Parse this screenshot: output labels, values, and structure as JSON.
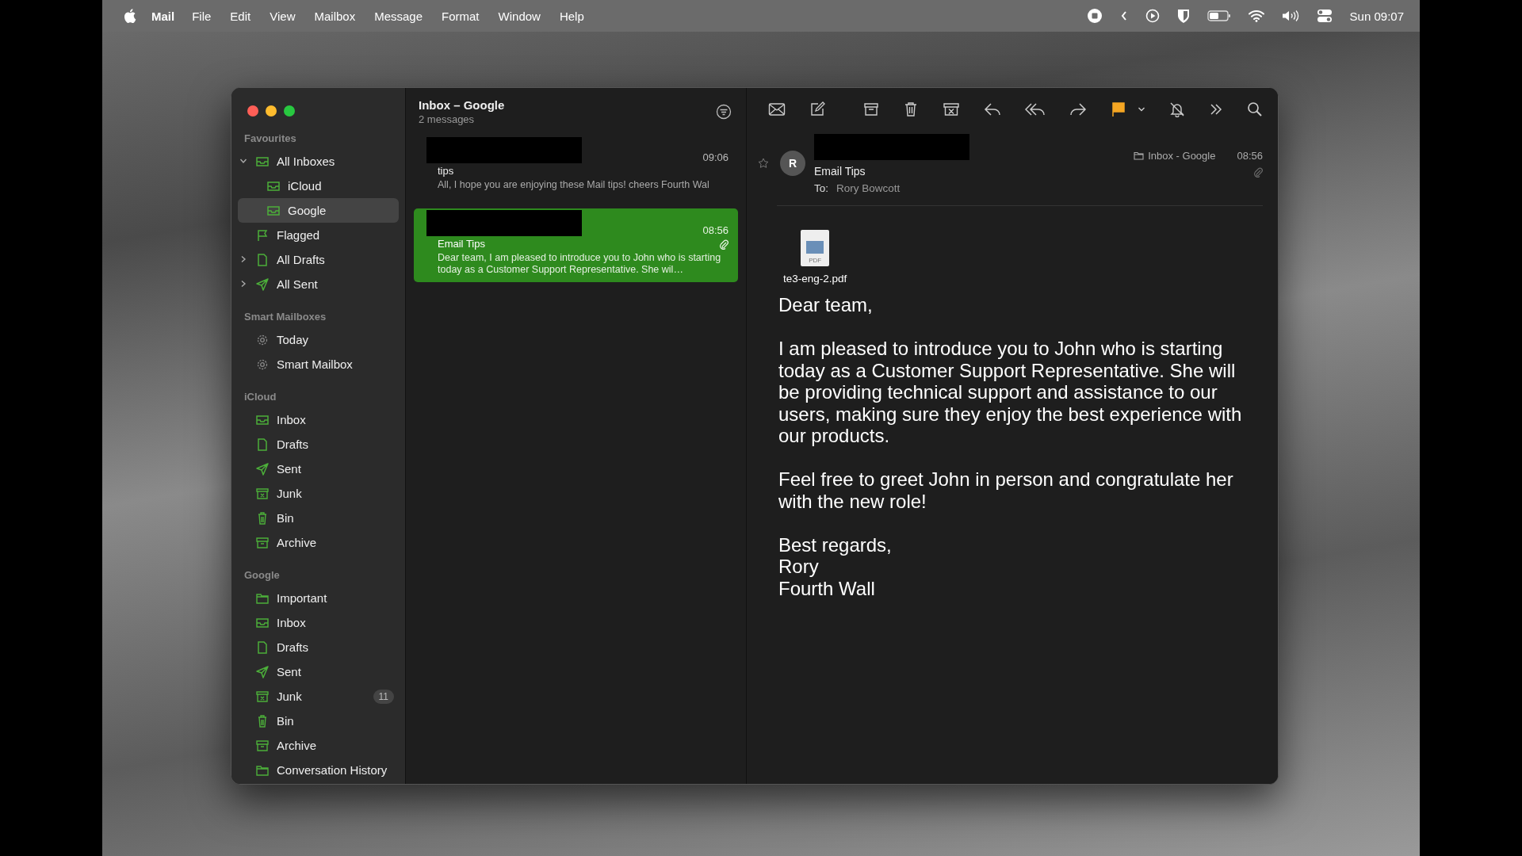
{
  "menu_bar": {
    "app_name": "Mail",
    "menus": [
      "File",
      "Edit",
      "View",
      "Mailbox",
      "Message",
      "Format",
      "Window",
      "Help"
    ],
    "clock": "Sun 09:07"
  },
  "sidebar": {
    "sections": [
      {
        "title": "Favourites",
        "items": [
          {
            "label": "All Inboxes",
            "kind": "inbox",
            "selected": false,
            "expanded": true,
            "children": [
              {
                "label": "iCloud",
                "kind": "inbox",
                "selected": false
              },
              {
                "label": "Google",
                "kind": "inbox",
                "selected": true
              }
            ]
          },
          {
            "label": "Flagged",
            "kind": "flag",
            "selected": false
          },
          {
            "label": "All Drafts",
            "kind": "drafts",
            "selected": false,
            "expanded": false
          },
          {
            "label": "All Sent",
            "kind": "sent",
            "selected": false,
            "expanded": false
          }
        ]
      },
      {
        "title": "Smart Mailboxes",
        "items": [
          {
            "label": "Today",
            "kind": "smart",
            "selected": false
          },
          {
            "label": "Smart Mailbox",
            "kind": "smart",
            "selected": false
          }
        ]
      },
      {
        "title": "iCloud",
        "items": [
          {
            "label": "Inbox",
            "kind": "inbox",
            "selected": false
          },
          {
            "label": "Drafts",
            "kind": "drafts",
            "selected": false
          },
          {
            "label": "Sent",
            "kind": "sent",
            "selected": false
          },
          {
            "label": "Junk",
            "kind": "junk",
            "selected": false
          },
          {
            "label": "Bin",
            "kind": "bin",
            "selected": false
          },
          {
            "label": "Archive",
            "kind": "archive",
            "selected": false
          }
        ]
      },
      {
        "title": "Google",
        "items": [
          {
            "label": "Important",
            "kind": "folder",
            "selected": false
          },
          {
            "label": "Inbox",
            "kind": "inbox",
            "selected": false
          },
          {
            "label": "Drafts",
            "kind": "drafts",
            "selected": false
          },
          {
            "label": "Sent",
            "kind": "sent",
            "selected": false
          },
          {
            "label": "Junk",
            "kind": "junk",
            "selected": false,
            "badge": "11"
          },
          {
            "label": "Bin",
            "kind": "bin",
            "selected": false
          },
          {
            "label": "Archive",
            "kind": "archive",
            "selected": false
          },
          {
            "label": "Conversation History",
            "kind": "folder",
            "selected": false
          }
        ]
      }
    ]
  },
  "message_list": {
    "title": "Inbox – Google",
    "count": "2 messages",
    "messages": [
      {
        "time": "09:06",
        "subject": "tips",
        "preview": "All, I hope you are enjoying these Mail tips! cheers Fourth Wal",
        "selected": false,
        "attachment": false
      },
      {
        "time": "08:56",
        "subject": "Email Tips",
        "preview": "Dear team, I am pleased to introduce you to John who is starting today as a Customer Support Representative. She wil…",
        "selected": true,
        "attachment": true
      }
    ]
  },
  "reader": {
    "avatar": "R",
    "subject": "Email Tips",
    "to_label": "To:",
    "to": "Rory Bowcott",
    "mailbox": "Inbox - Google",
    "time": "08:56",
    "attachment": {
      "file_type": "PDF",
      "name": "te3-eng-2.pdf"
    },
    "body": [
      {
        "lines": [
          "Dear team,"
        ]
      },
      {
        "lines": [
          "I am pleased to introduce you to John who is starting today as a Customer Support Representative. She will be providing technical support and assistance to our users, making sure they enjoy the best experience with our products."
        ]
      },
      {
        "lines": [
          "Feel free to greet John in person and congratulate her with the new role!"
        ]
      },
      {
        "lines": [
          "Best regards,",
          "Rory",
          "Fourth Wall"
        ]
      }
    ]
  }
}
